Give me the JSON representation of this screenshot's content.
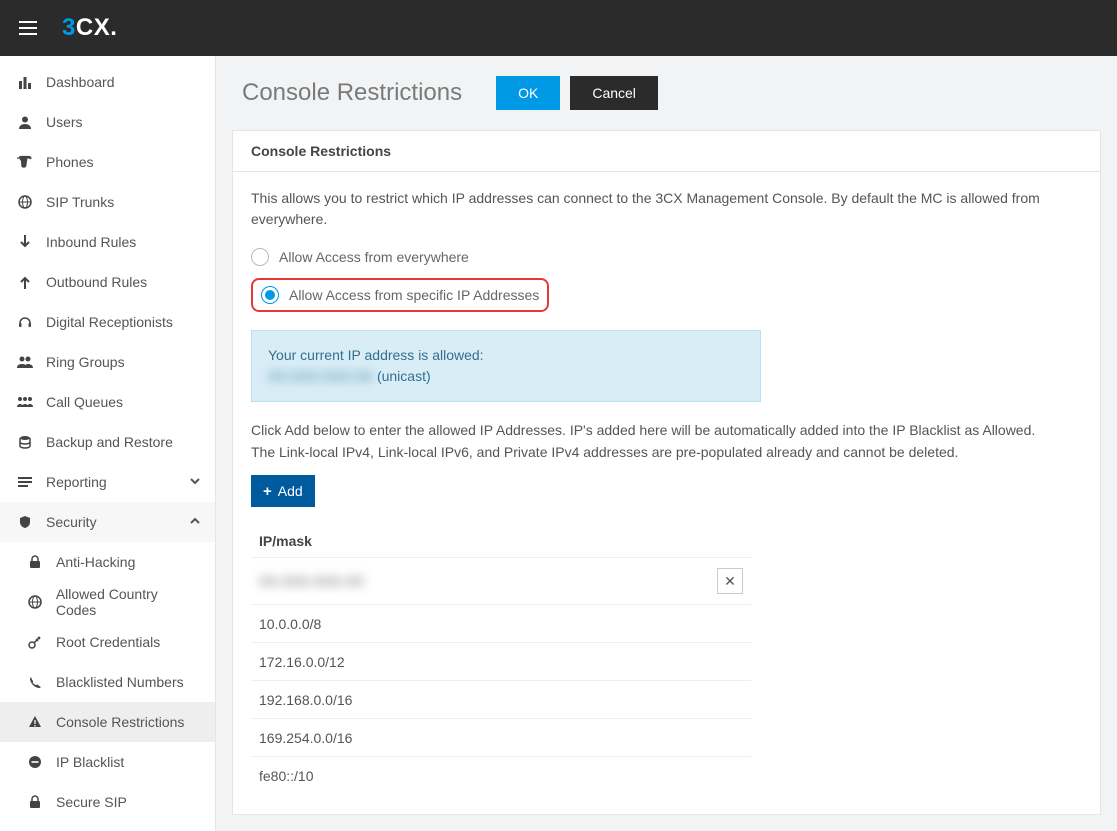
{
  "logo": {
    "three": "3",
    "cx": "CX",
    "dot": "."
  },
  "sidebar": {
    "items": [
      {
        "icon": "bar-chart-icon",
        "label": "Dashboard"
      },
      {
        "icon": "user-icon",
        "label": "Users"
      },
      {
        "icon": "phone-icon",
        "label": "Phones"
      },
      {
        "icon": "globe-icon",
        "label": "SIP Trunks"
      },
      {
        "icon": "arrow-down-icon",
        "label": "Inbound Rules"
      },
      {
        "icon": "arrow-up-icon",
        "label": "Outbound Rules"
      },
      {
        "icon": "headset-icon",
        "label": "Digital Receptionists"
      },
      {
        "icon": "users-icon",
        "label": "Ring Groups"
      },
      {
        "icon": "queue-icon",
        "label": "Call Queues"
      },
      {
        "icon": "database-icon",
        "label": "Backup and Restore"
      },
      {
        "icon": "list-icon",
        "label": "Reporting",
        "chevron": "down"
      },
      {
        "icon": "shield-icon",
        "label": "Security",
        "chevron": "up",
        "expanded": true
      }
    ],
    "security_sub": [
      {
        "icon": "lock-icon",
        "label": "Anti-Hacking"
      },
      {
        "icon": "globe-icon",
        "label": "Allowed Country Codes"
      },
      {
        "icon": "key-icon",
        "label": "Root Credentials"
      },
      {
        "icon": "phone-small-icon",
        "label": "Blacklisted Numbers"
      },
      {
        "icon": "warning-icon",
        "label": "Console Restrictions",
        "active": true
      },
      {
        "icon": "minus-circle-icon",
        "label": "IP Blacklist"
      },
      {
        "icon": "lock-icon",
        "label": "Secure SIP"
      }
    ]
  },
  "page": {
    "title": "Console Restrictions",
    "ok": "OK",
    "cancel": "Cancel"
  },
  "panel": {
    "header": "Console Restrictions",
    "description": "This allows you to restrict which IP addresses can connect to the 3CX Management Console. By default the MC is allowed from everywhere.",
    "radio_everywhere": "Allow Access from everywhere",
    "radio_specific": "Allow Access from specific IP Addresses",
    "info_line1": "Your current IP address is allowed:",
    "info_masked": "XX.XXX.XXX.XX",
    "info_suffix": " (unicast)",
    "instructions_l1": "Click Add below to enter the allowed IP Addresses. IP's added here will be automatically added into the IP Blacklist as Allowed.",
    "instructions_l2": "The Link-local IPv4, Link-local IPv6, and Private IPv4 addresses are pre-populated already and cannot be deleted.",
    "add_label": "Add",
    "table_header": "IP/mask",
    "rows": [
      {
        "ip": "XX.XXX.XXX.XX",
        "masked": true,
        "removable": true
      },
      {
        "ip": "10.0.0.0/8"
      },
      {
        "ip": "172.16.0.0/12"
      },
      {
        "ip": "192.168.0.0/16"
      },
      {
        "ip": "169.254.0.0/16"
      },
      {
        "ip": "fe80::/10"
      }
    ]
  }
}
